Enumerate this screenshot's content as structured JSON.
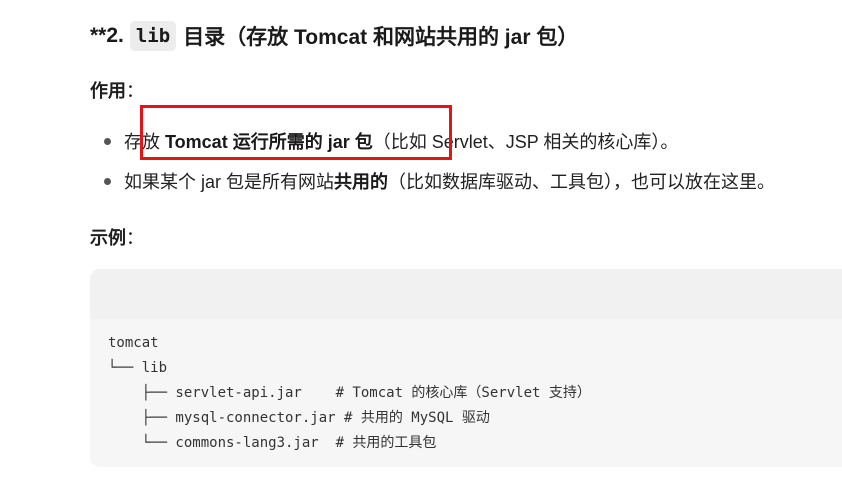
{
  "heading": {
    "prefix": "**2.",
    "code": "lib",
    "title": "目录（存放 Tomcat 和网站共用的 jar 包）"
  },
  "usage": {
    "label": "作用",
    "colon": "：",
    "bullets": [
      {
        "pre": "存放 ",
        "bold": "Tomcat 运行所需的 jar 包",
        "post": "（比如 Servlet、JSP 相关的核心库）。"
      },
      {
        "pre": "如果某个 jar 包是所有网站",
        "bold": "共用的",
        "post": "（比如数据库驱动、工具包），也可以放在这里。"
      }
    ]
  },
  "example": {
    "label": "示例",
    "colon": "：",
    "code_lines": [
      "tomcat",
      "└── lib",
      "    ├── servlet-api.jar    # Tomcat 的核心库（Servlet 支持）",
      "    ├── mysql-connector.jar # 共用的 MySQL 驱动",
      "    └── commons-lang3.jar  # 共用的工具包"
    ]
  },
  "colors": {
    "highlight_border": "#e0161b",
    "code_background": "#f6f6f6"
  }
}
